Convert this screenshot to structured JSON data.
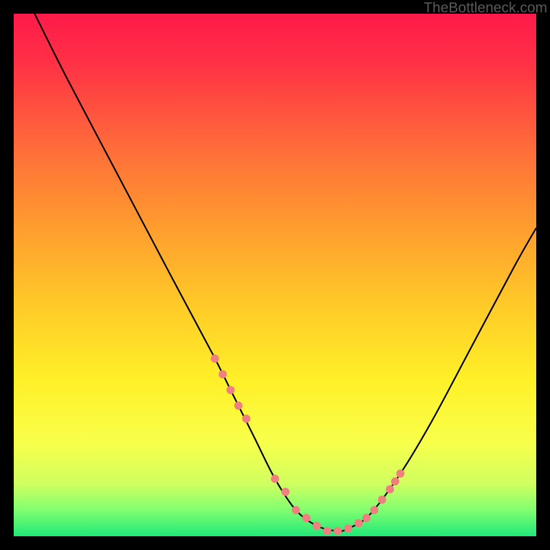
{
  "watermark": "TheBottleneck.com",
  "gradient": {
    "stops": [
      {
        "offset": "0%",
        "color": "#ff1a4a"
      },
      {
        "offset": "10%",
        "color": "#ff3345"
      },
      {
        "offset": "25%",
        "color": "#ff6a3a"
      },
      {
        "offset": "40%",
        "color": "#ff9a2f"
      },
      {
        "offset": "55%",
        "color": "#ffc828"
      },
      {
        "offset": "70%",
        "color": "#fff028"
      },
      {
        "offset": "82%",
        "color": "#f8ff4a"
      },
      {
        "offset": "90%",
        "color": "#d0ff60"
      },
      {
        "offset": "95%",
        "color": "#80ff70"
      },
      {
        "offset": "100%",
        "color": "#20e878"
      }
    ]
  },
  "chart_data": {
    "type": "line",
    "title": "",
    "xlabel": "",
    "ylabel": "",
    "xlim": [
      0,
      100
    ],
    "ylim": [
      0,
      100
    ],
    "series": [
      {
        "name": "curve",
        "x": [
          4,
          10,
          20,
          30,
          38,
          42,
          46,
          50,
          54,
          58,
          62,
          64,
          68,
          74,
          80,
          88,
          96,
          100
        ],
        "y": [
          100,
          88,
          69,
          50,
          35,
          27,
          19,
          11,
          5,
          2,
          1,
          1.5,
          4,
          12,
          22,
          37,
          52,
          59
        ]
      }
    ],
    "dots": {
      "name": "highlight",
      "color": "#f08080",
      "radius_px": 6,
      "x": [
        38.5,
        40,
        41.5,
        43,
        44.5,
        50,
        52,
        54,
        56,
        58,
        60,
        62,
        64,
        66,
        67.5,
        69,
        70.5,
        72,
        73,
        74
      ],
      "y": [
        34,
        31,
        28,
        25,
        22.5,
        11,
        8.5,
        5,
        3.5,
        2,
        1,
        1,
        1.5,
        2.5,
        3.5,
        5,
        7,
        9,
        10.5,
        12
      ]
    }
  }
}
